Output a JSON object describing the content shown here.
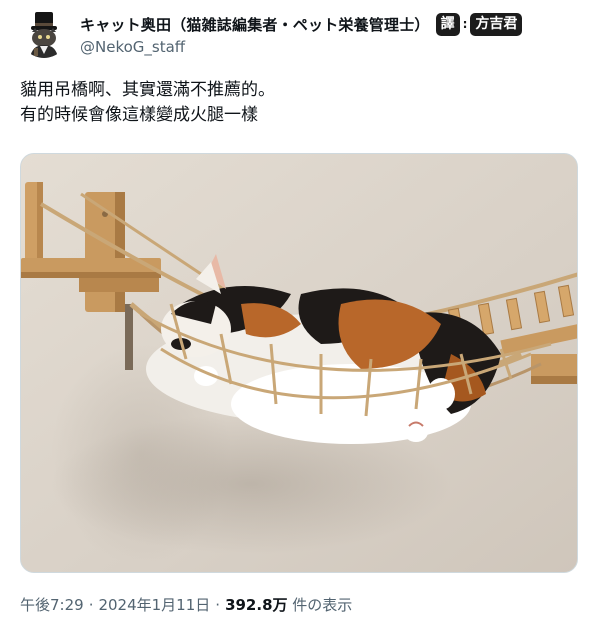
{
  "author": {
    "display_name": "キャット奥田（猫雑誌編集者・ペット栄養管理士）",
    "handle": "@NekoG_staff",
    "avatar_icon": "cat-with-top-hat-avatar"
  },
  "translator_badge": {
    "label": "譯",
    "separator": ":",
    "name": "方吉君"
  },
  "tweet": {
    "lines": [
      "貓用吊橋啊、其實還滿不推薦的。",
      "有的時候會像這樣變成火腿一樣"
    ]
  },
  "photo": {
    "icon": "cat-in-rope-bridge-photo",
    "colors": {
      "wall": "#ddd6cd",
      "wood": "#c99a60",
      "rope": "#c9a777",
      "cat_orange": "#b8672a",
      "cat_black": "#1e1a18"
    }
  },
  "meta": {
    "time": "午後7:29",
    "date": "2024年1月11日",
    "separator": "·",
    "views_count": "392.8万",
    "views_label": "件の表示"
  }
}
